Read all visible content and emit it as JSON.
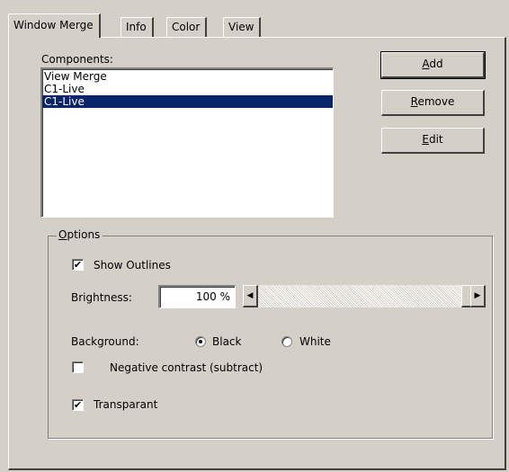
{
  "tabs": [
    {
      "label": "Window Merge",
      "active": true
    },
    {
      "label": "Info",
      "active": false
    },
    {
      "label": "Color",
      "active": false
    },
    {
      "label": "View",
      "active": false
    }
  ],
  "components": {
    "label": "Components:",
    "items": [
      {
        "text": "View Merge",
        "selected": false
      },
      {
        "text": "C1-Live",
        "selected": false
      },
      {
        "text": "C1-Live",
        "selected": true
      }
    ]
  },
  "buttons": {
    "add": {
      "mnemonic": "A",
      "rest": "dd"
    },
    "remove": {
      "mnemonic": "R",
      "rest": "emove"
    },
    "edit": {
      "mnemonic": "E",
      "rest": "dit"
    }
  },
  "options": {
    "group_mnemonic": "O",
    "group_rest": "ptions",
    "show_outlines": {
      "label": "Show Outlines",
      "checked": true
    },
    "brightness": {
      "label": "Brightness:",
      "value": "100 %",
      "level": 1.0
    },
    "background": {
      "label": "Background:",
      "options": [
        {
          "label": "Black",
          "selected": true
        },
        {
          "label": "White",
          "selected": false
        }
      ]
    },
    "negative_contrast": {
      "label": "Negative contrast (subtract)",
      "checked": false
    },
    "transparant": {
      "label": "Transparant",
      "checked": true
    }
  },
  "glyphs": {
    "check": "✔",
    "arrow_left": "◀",
    "arrow_right": "▶"
  },
  "colors": {
    "face": "#d4d0c8",
    "selection": "#0a246a"
  }
}
